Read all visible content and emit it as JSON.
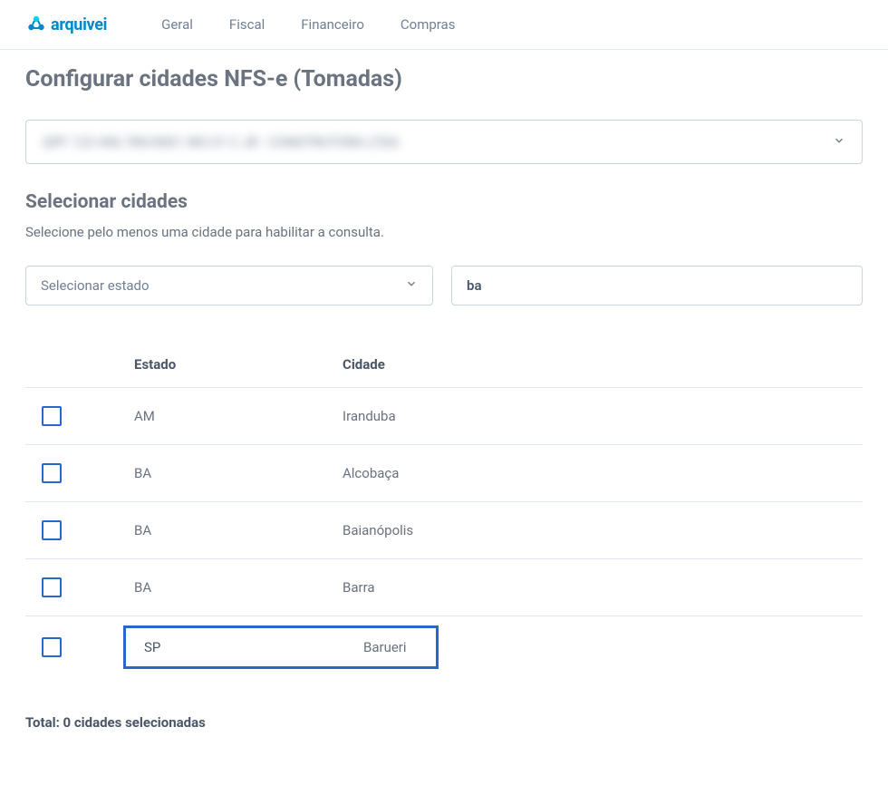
{
  "header": {
    "logo_text": "arquivei",
    "nav": [
      "Geral",
      "Fiscal",
      "Financeiro",
      "Compras"
    ]
  },
  "page": {
    "title": "Configurar cidades NFS-e (Tomadas)",
    "company_placeholder": "QPF 123 456.789/0001 WG 01 C JR - CONSTRUTORA LTDA",
    "section_title": "Selecionar cidades",
    "section_subtitle": "Selecione pelo menos uma cidade para habilitar a consulta.",
    "state_select_label": "Selecionar estado",
    "city_search_value": "ba"
  },
  "table": {
    "headers": {
      "estado": "Estado",
      "cidade": "Cidade"
    },
    "rows": [
      {
        "estado": "AM",
        "cidade": "Iranduba"
      },
      {
        "estado": "BA",
        "cidade": "Alcobaça"
      },
      {
        "estado": "BA",
        "cidade": "Baianópolis"
      },
      {
        "estado": "BA",
        "cidade": "Barra"
      },
      {
        "estado": "SP",
        "cidade": "Barueri"
      }
    ],
    "total_label": "Total: 0 cidades selecionadas"
  }
}
